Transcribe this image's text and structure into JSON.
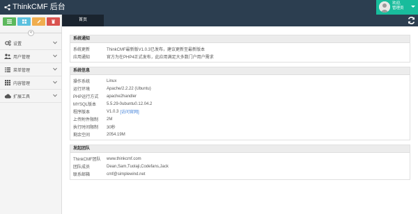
{
  "header": {
    "title": "ThinkCMF 后台",
    "user_greeting": "欢迎,",
    "user_role": "管理员"
  },
  "sidebar": {
    "collapse_glyph": "«",
    "shortcuts": [
      {
        "icon": "list-icon",
        "color": "#5cb85c"
      },
      {
        "icon": "grid-icon",
        "color": "#5bc0de"
      },
      {
        "icon": "pencil-icon",
        "color": "#f0ad4e"
      },
      {
        "icon": "trash-icon",
        "color": "#d9534f"
      }
    ],
    "items": [
      {
        "label": "设置",
        "icon": "gears-icon"
      },
      {
        "label": "用户管理",
        "icon": "users-icon"
      },
      {
        "label": "菜单管理",
        "icon": "list-icon"
      },
      {
        "label": "内容管理",
        "icon": "th-icon"
      },
      {
        "label": "扩展工具",
        "icon": "cloud-icon"
      }
    ]
  },
  "tabs": [
    {
      "label": "首页"
    }
  ],
  "panels": {
    "notice": {
      "title": "系统通知",
      "rows": [
        {
          "key": "系统更新",
          "value": "ThinkCMF最新版V1.0.3已发布，建议更新至最新版本"
        },
        {
          "key": "应用通知",
          "value": "官方为在PHP4正式发布，此应用满足大多数门户用户需求"
        }
      ]
    },
    "sysinfo": {
      "title": "系统信息",
      "rows": [
        {
          "key": "操作系统",
          "value": "Linux"
        },
        {
          "key": "运行环境",
          "value": "Apache/2.2.22 (Ubuntu)"
        },
        {
          "key": "PHP运行方式",
          "value": "apache2handler"
        },
        {
          "key": "MYSQL版本",
          "value": "5.5.29-0ubuntu0.12.04.2"
        },
        {
          "key": "程序版本",
          "value": "V1.0.3",
          "link": "[访问官网]"
        },
        {
          "key": "上传附件限制",
          "value": "2M"
        },
        {
          "key": "执行时间限制",
          "value": "30秒"
        },
        {
          "key": "剩余空间",
          "value": "2054.19M"
        }
      ]
    },
    "team": {
      "title": "发起团队",
      "rows": [
        {
          "key": "ThinkCMF团队",
          "value": "www.thinkcmf.com"
        },
        {
          "key": "团队成员",
          "value": "Dean,Sam,Tuolaji,Codefans,Jack"
        },
        {
          "key": "联系邮箱",
          "value": "cmf@simplewind.net"
        }
      ]
    }
  },
  "colors": {
    "topbar": "#2c3e50",
    "user_box": "#18bc9c",
    "link": "#3b7dd8"
  }
}
